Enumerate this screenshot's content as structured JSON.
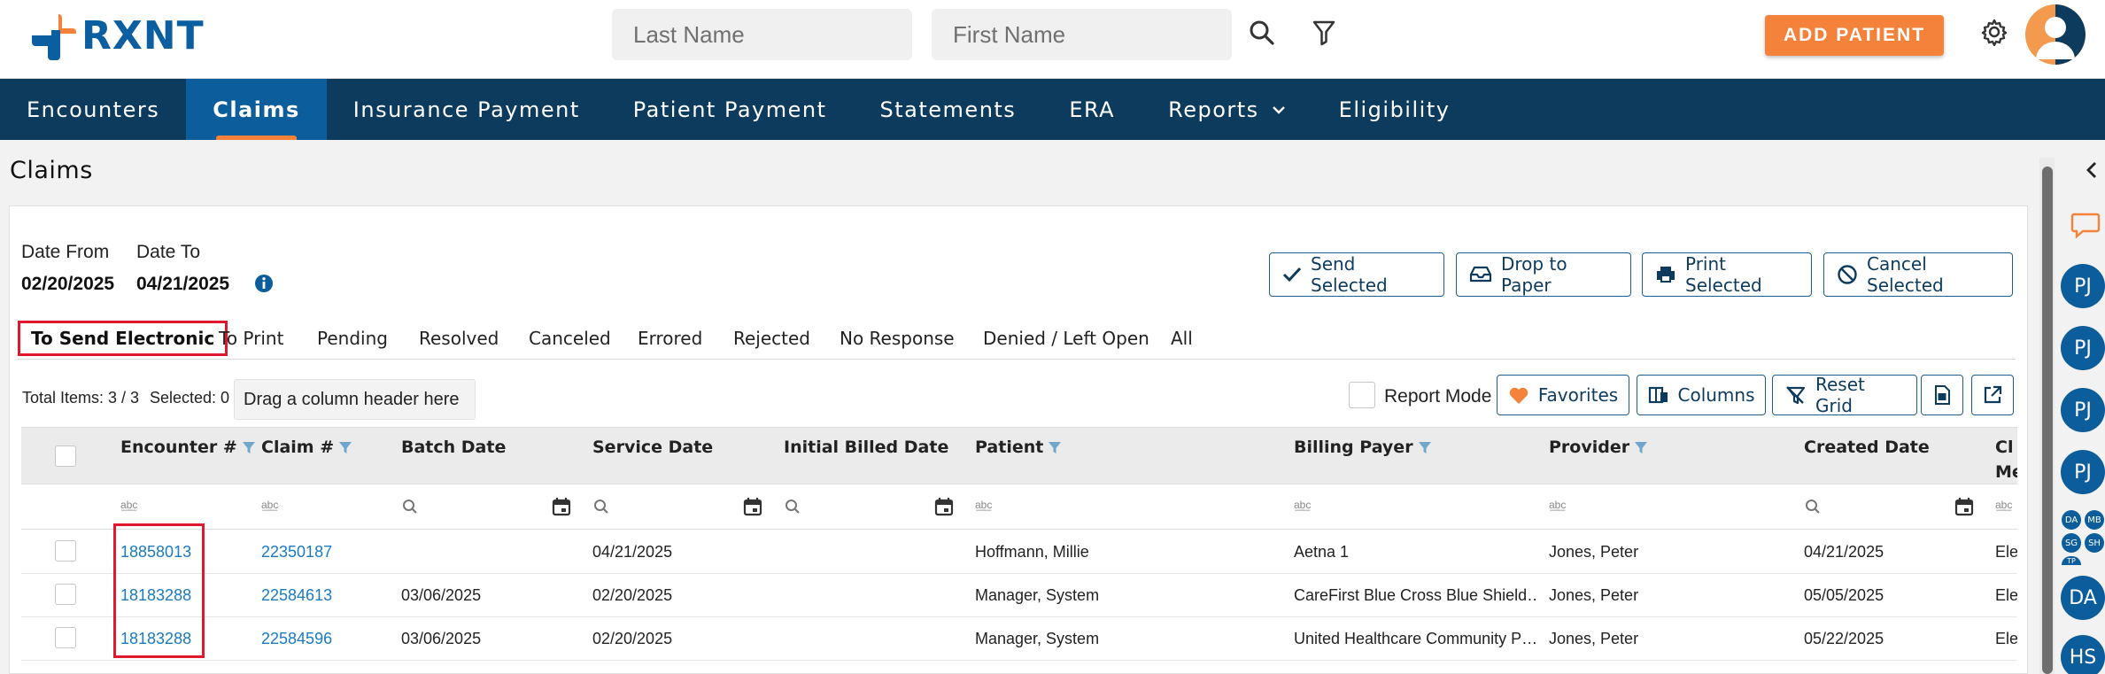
{
  "brand": {
    "name": "RXNT"
  },
  "header": {
    "last_name_placeholder": "Last Name",
    "first_name_placeholder": "First Name",
    "add_patient_label": "ADD PATIENT"
  },
  "nav": {
    "items": [
      "Encounters",
      "Claims",
      "Insurance Payment",
      "Patient Payment",
      "Statements",
      "ERA",
      "Reports",
      "Eligibility"
    ],
    "active": "Claims"
  },
  "page": {
    "title": "Claims"
  },
  "filters": {
    "date_from_label": "Date From",
    "date_from_value": "02/20/2025",
    "date_to_label": "Date To",
    "date_to_value": "04/21/2025"
  },
  "actions": {
    "send_selected": "Send Selected",
    "drop_to_paper": "Drop to Paper",
    "print_selected": "Print Selected",
    "cancel_selected": "Cancel Selected"
  },
  "subtabs": [
    "To Send Electronic",
    "To Print",
    "Pending",
    "Resolved",
    "Canceled",
    "Errored",
    "Rejected",
    "No Response",
    "Denied / Left Open",
    "All"
  ],
  "toolbar": {
    "total_items": "Total Items: 3 / 3",
    "selected": "Selected: 0",
    "drag_hint": "Drag a column header here",
    "report_mode": "Report Mode",
    "favorites": "Favorites",
    "columns": "Columns",
    "reset_grid": "Reset Grid"
  },
  "grid": {
    "columns": [
      "Encounter #",
      "Claim #",
      "Batch Date",
      "Service Date",
      "Initial Billed Date",
      "Patient",
      "Billing Payer",
      "Provider",
      "Created Date",
      "Cl",
      "Me"
    ],
    "filter_text_glyph": "a͟b͟c",
    "rows": [
      {
        "encounter": "18858013",
        "claim": "22350187",
        "batch_date": "",
        "service_date": "04/21/2025",
        "initial_billed": "",
        "patient": "Hoffmann, Millie",
        "payer": "Aetna 1",
        "provider": "Jones, Peter",
        "created": "04/21/2025",
        "cl": "Ele"
      },
      {
        "encounter": "18183288",
        "claim": "22584613",
        "batch_date": "03/06/2025",
        "service_date": "02/20/2025",
        "initial_billed": "",
        "patient": "Manager, System",
        "payer": "CareFirst Blue Cross Blue Shield…",
        "provider": "Jones, Peter",
        "created": "05/05/2025",
        "cl": "Ele"
      },
      {
        "encounter": "18183288",
        "claim": "22584596",
        "batch_date": "03/06/2025",
        "service_date": "02/20/2025",
        "initial_billed": "",
        "patient": "Manager, System",
        "payer": "United Healthcare Community P…",
        "provider": "Jones, Peter",
        "created": "05/22/2025",
        "cl": "Ele"
      }
    ]
  },
  "rail": {
    "badges": [
      "PJ",
      "PJ",
      "PJ",
      "PJ",
      "DA",
      "HS"
    ],
    "mini_badges": [
      "DA",
      "MB",
      "SG",
      "SH",
      "TP"
    ]
  },
  "colors": {
    "nav_bg": "#0d3b5d",
    "nav_active": "#0c5d9b",
    "accent_orange": "#f5823a",
    "link_blue": "#1a7bbf",
    "highlight_red": "#e0182d"
  }
}
